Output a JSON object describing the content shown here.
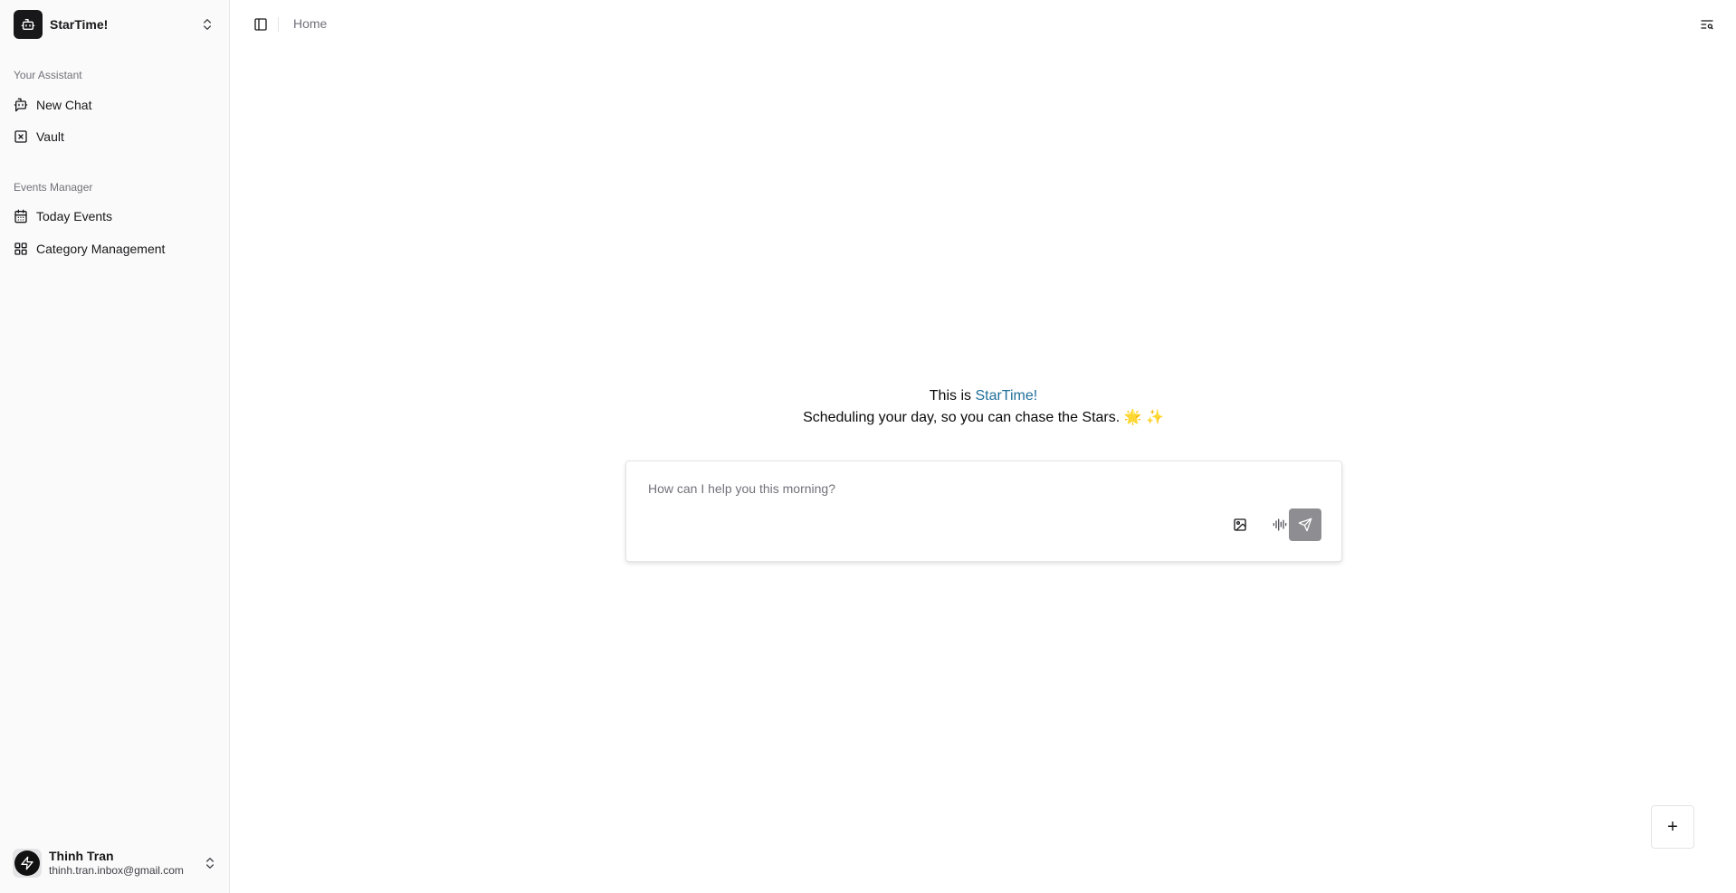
{
  "brand": {
    "name": "StarTime!",
    "logo_icon": "bot-icon"
  },
  "sidebar": {
    "groups": [
      {
        "label": "Your Assistant",
        "items": [
          {
            "label": "New Chat",
            "icon": "bot-message-icon"
          },
          {
            "label": "Vault",
            "icon": "square-x-icon"
          }
        ]
      },
      {
        "label": "Events Manager",
        "items": [
          {
            "label": "Today Events",
            "icon": "calendar-icon"
          },
          {
            "label": "Category Management",
            "icon": "grid-icon"
          }
        ]
      }
    ]
  },
  "user": {
    "name": "Thinh Tran",
    "email": "thinh.tran.inbox@gmail.com"
  },
  "header": {
    "breadcrumb": "Home"
  },
  "hero": {
    "prefix": "This is ",
    "brand": "StarTime!",
    "tagline": "Scheduling your day, so you can chase the Stars. 🌟 ✨"
  },
  "composer": {
    "placeholder": "How can I help you this morning?",
    "value": ""
  },
  "fab": {
    "label": "+"
  },
  "colors": {
    "accent": "#1f6f9a",
    "brand_bg": "#18181b",
    "send_bg": "#8e8e92"
  }
}
